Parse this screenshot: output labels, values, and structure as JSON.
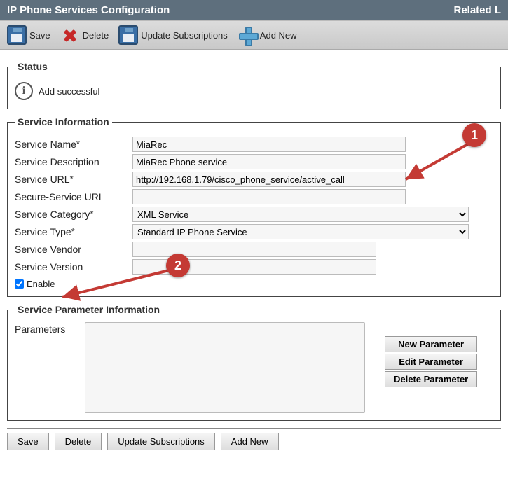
{
  "header": {
    "title": "IP Phone Services Configuration",
    "right": "Related L"
  },
  "toolbar": {
    "save": "Save",
    "delete": "Delete",
    "update": "Update Subscriptions",
    "addnew": "Add New"
  },
  "status": {
    "legend": "Status",
    "message": "Add successful"
  },
  "service": {
    "legend": "Service Information",
    "fields": {
      "name_label": "Service Name",
      "name_value": "MiaRec",
      "desc_label": "Service Description",
      "desc_value": "MiaRec Phone service",
      "url_label": "Service URL",
      "url_value": "http://192.168.1.79/cisco_phone_service/active_call",
      "secure_label": "Secure-Service URL",
      "secure_value": "",
      "category_label": "Service Category",
      "category_value": "XML Service",
      "type_label": "Service Type",
      "type_value": "Standard IP Phone Service",
      "vendor_label": "Service Vendor",
      "vendor_value": "",
      "version_label": "Service Version",
      "version_value": "",
      "enable_label": "Enable",
      "enable_checked": true
    }
  },
  "params": {
    "legend": "Service Parameter Information",
    "label": "Parameters",
    "buttons": {
      "new": "New Parameter",
      "edit": "Edit Parameter",
      "delete": "Delete Parameter"
    }
  },
  "footer": {
    "save": "Save",
    "delete": "Delete",
    "update": "Update Subscriptions",
    "addnew": "Add New"
  },
  "annotations": {
    "badge1": "1",
    "badge2": "2"
  }
}
